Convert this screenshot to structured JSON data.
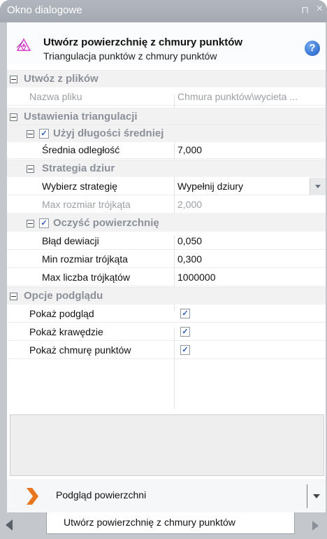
{
  "window": {
    "title": "Okno dialogowe",
    "pin_glyph": "⊓",
    "close_glyph": "×"
  },
  "header": {
    "title": "Utwórz powierzchnię z chmury punktów",
    "subtitle": "Triangulacja punktów z chmury punktów",
    "icon": "triangulation-icon",
    "help_glyph": "?"
  },
  "grid": {
    "categories": {
      "from_files": "Utwóz z plików",
      "triangulation": "Ustawienia triangulacji",
      "use_avg": "Użyj długości średniej",
      "holes": "Strategia dziur",
      "clean": "Oczyść powierzchnię",
      "preview": "Opcje podglądu"
    },
    "props": {
      "file_name": {
        "label": "Nazwa pliku",
        "value": "Chmura punktów\\wycieta ..."
      },
      "avg_distance": {
        "label": "Średnia odległość",
        "value": "7,000"
      },
      "strategy": {
        "label": "Wybierz strategię",
        "value": "Wypełnij dziury"
      },
      "max_triangle": {
        "label": "Max rozmiar trójkąta",
        "value": "2,000"
      },
      "deviation": {
        "label": "Błąd dewiacji",
        "value": "0,050"
      },
      "min_triangle": {
        "label": "Min rozmiar trójkąta",
        "value": "0,300"
      },
      "max_count": {
        "label": "Max liczba trójkątów",
        "value": "1000000"
      },
      "show_preview": {
        "label": "Pokaż podgląd",
        "checked": true
      },
      "show_edges": {
        "label": "Pokaż krawędzie",
        "checked": true
      },
      "show_cloud": {
        "label": "Pokaż chmurę punktów",
        "checked": true
      }
    },
    "check_glyph": "✓"
  },
  "preview_bar": {
    "label": "Podgląd powierzchni"
  },
  "tab": {
    "label": "Utwórz powierzchnię z chmury punktów"
  },
  "colors": {
    "accent_orange": "#e8761e",
    "icon_magenta": "#d43cc8"
  }
}
